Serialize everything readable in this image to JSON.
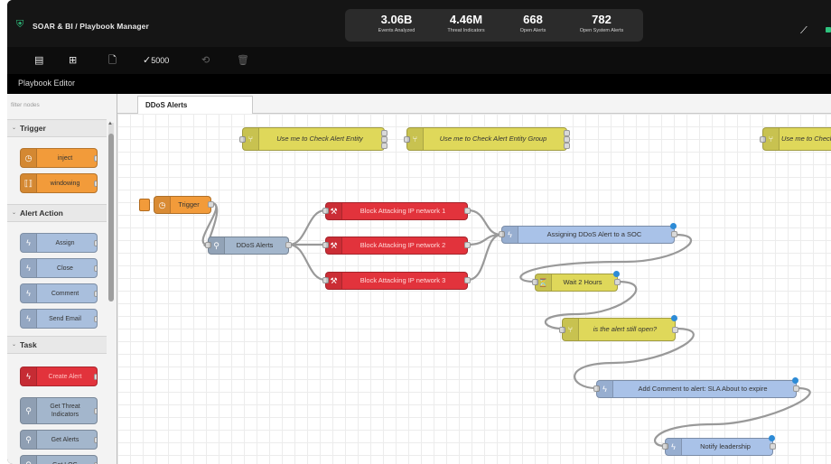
{
  "header": {
    "title": "SOAR & BI / Playbook Manager",
    "stats": [
      {
        "value": "3.06B",
        "label": "Events Analyzed"
      },
      {
        "value": "4.46M",
        "label": "Threat Indicators"
      },
      {
        "value": "668",
        "label": "Open Alerts"
      },
      {
        "value": "782",
        "label": "Open System Alerts"
      }
    ],
    "logo_icon": "shield-icon",
    "trend_icon": "trend-icon"
  },
  "toolbar": {
    "check_label": "5000",
    "icons": [
      "list-icon",
      "add-box-icon",
      "add-file-icon",
      "check-icon",
      "refresh-icon",
      "trash-icon"
    ]
  },
  "editor": {
    "title": "Playbook Editor"
  },
  "palette": {
    "filter_placeholder": "filter nodes",
    "categories": [
      {
        "label": "Trigger",
        "nodes": [
          "inject",
          "windowing"
        ]
      },
      {
        "label": "Alert Action",
        "nodes": [
          "Assign",
          "Close",
          "Comment",
          "Send Email"
        ]
      },
      {
        "label": "Task",
        "nodes": [
          "Create Alert",
          "Get Threat Indicators",
          "Get Alerts",
          "Get LOG"
        ]
      }
    ]
  },
  "workspace": {
    "tab": "DDoS Alerts",
    "nodes": {
      "switch1": "Use me to Check Alert Entity",
      "switch2": "Use me to Check Alert Entity Group",
      "switch3": "Use me to Check Alert Entity",
      "trigger": "Trigger",
      "ddos": "DDoS Alerts",
      "block1": "Block Attacking IP network 1",
      "block2": "Block Attacking IP network 2",
      "block3": "Block Attacking IP network 3",
      "assign": "Assigning DDoS Alert to a SOC",
      "wait": "Wait 2 Hours",
      "open": "is the alert still open?",
      "comment": "Add Comment to alert: SLA About to expire",
      "notify": "Notify leadership"
    }
  },
  "colors": {
    "orange": "#f29b3a",
    "red": "#e2333c",
    "yellow": "#dfd85a",
    "blue": "#a9c2e8",
    "grayblue": "#a3b6cc",
    "accent_green": "#2ec27e"
  }
}
